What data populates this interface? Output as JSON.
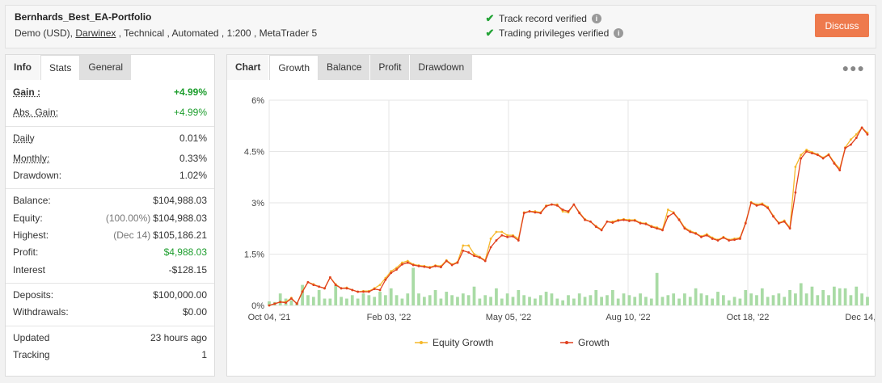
{
  "account": {
    "name": "Bernhards_Best_EA-Portfolio",
    "desc_prefix": "Demo (USD),",
    "broker": "Darwinex",
    "desc_suffix": ", Technical , Automated , 1:200 , MetaTrader 5"
  },
  "verification": [
    {
      "text": "Track record verified",
      "icon": "check-icon"
    },
    {
      "text": "Trading privileges verified",
      "icon": "check-icon"
    }
  ],
  "discuss_label": "Discuss",
  "left_tabs": [
    "Info",
    "Stats",
    "General"
  ],
  "stats": {
    "gain": {
      "label": "Gain :",
      "value": "+4.99%"
    },
    "abs_gain": {
      "label": "Abs. Gain:",
      "value": "+4.99%"
    },
    "daily": {
      "label": "Daily",
      "value": "0.01%"
    },
    "monthly": {
      "label": "Monthly:",
      "value": "0.33%"
    },
    "drawdown": {
      "label": "Drawdown:",
      "value": "1.02%"
    },
    "balance": {
      "label": "Balance:",
      "value": "$104,988.03"
    },
    "equity": {
      "label": "Equity:",
      "sub": "(100.00%)",
      "value": "$104,988.03"
    },
    "highest": {
      "label": "Highest:",
      "sub": "(Dec 14)",
      "value": "$105,186.21"
    },
    "profit": {
      "label": "Profit:",
      "value": "$4,988.03"
    },
    "interest": {
      "label": "Interest",
      "value": "-$128.15"
    },
    "deposits": {
      "label": "Deposits:",
      "value": "$100,000.00"
    },
    "withdrawals": {
      "label": "Withdrawals:",
      "value": "$0.00"
    },
    "updated": {
      "label": "Updated",
      "value": "23 hours ago"
    },
    "tracking": {
      "label": "Tracking",
      "value": "1"
    }
  },
  "right_tabs": [
    "Chart",
    "Growth",
    "Balance",
    "Profit",
    "Drawdown"
  ],
  "menu_icon": "more-dots-icon",
  "colors": {
    "accent": "#ee7a4d",
    "green": "#1e9e2e",
    "equity": "#f6b82b",
    "growth": "#e0401f",
    "bars": "#a9dba5"
  },
  "chart_data": {
    "type": "line",
    "y_ticks": [
      "6%",
      "4.5%",
      "3%",
      "1.5%",
      "0%"
    ],
    "y_tick_values": [
      6,
      4.5,
      3,
      1.5,
      0
    ],
    "ylim": [
      0,
      6
    ],
    "x_ticks": [
      "Oct 04, '21",
      "Feb 03, '22",
      "May 05, '22",
      "Aug 10, '22",
      "Oct 18, '22",
      "Dec 14, '22"
    ],
    "legend": [
      "Equity Growth",
      "Growth"
    ],
    "grid": true,
    "series": [
      {
        "name": "Growth",
        "values": [
          0,
          0.05,
          0.1,
          0.08,
          0.2,
          0.05,
          0.4,
          0.68,
          0.6,
          0.55,
          0.5,
          0.82,
          0.6,
          0.5,
          0.5,
          0.45,
          0.4,
          0.4,
          0.4,
          0.48,
          0.45,
          0.75,
          0.95,
          1.05,
          1.2,
          1.25,
          1.18,
          1.15,
          1.13,
          1.1,
          1.15,
          1.12,
          1.3,
          1.18,
          1.25,
          1.6,
          1.55,
          1.45,
          1.4,
          1.3,
          1.7,
          1.9,
          2.05,
          2.0,
          2.02,
          1.9,
          2.7,
          2.75,
          2.72,
          2.7,
          2.9,
          2.95,
          2.92,
          2.8,
          2.75,
          2.95,
          2.7,
          2.5,
          2.45,
          2.3,
          2.2,
          2.45,
          2.42,
          2.48,
          2.5,
          2.47,
          2.48,
          2.4,
          2.38,
          2.3,
          2.25,
          2.2,
          2.6,
          2.7,
          2.5,
          2.25,
          2.15,
          2.1,
          2.0,
          2.05,
          1.95,
          1.9,
          1.98,
          1.9,
          1.92,
          1.95,
          2.4,
          3.0,
          2.92,
          2.95,
          2.85,
          2.6,
          2.4,
          2.45,
          2.25,
          3.3,
          4.3,
          4.5,
          4.45,
          4.4,
          4.3,
          4.4,
          4.15,
          3.95,
          4.6,
          4.7,
          4.9,
          5.2,
          5.0
        ]
      },
      {
        "name": "Equity Growth",
        "values": [
          0,
          0.05,
          0.1,
          0.1,
          0.22,
          0.05,
          0.42,
          0.68,
          0.62,
          0.55,
          0.5,
          0.82,
          0.62,
          0.5,
          0.52,
          0.45,
          0.4,
          0.42,
          0.42,
          0.5,
          0.6,
          0.8,
          1.0,
          1.1,
          1.25,
          1.3,
          1.2,
          1.17,
          1.15,
          1.12,
          1.17,
          1.15,
          1.32,
          1.2,
          1.27,
          1.75,
          1.75,
          1.5,
          1.42,
          1.32,
          1.95,
          2.15,
          2.15,
          2.05,
          2.05,
          1.95,
          2.72,
          2.75,
          2.75,
          2.72,
          2.92,
          2.95,
          2.95,
          2.75,
          2.72,
          2.95,
          2.72,
          2.52,
          2.45,
          2.32,
          2.22,
          2.45,
          2.45,
          2.5,
          2.52,
          2.5,
          2.5,
          2.42,
          2.4,
          2.32,
          2.28,
          2.22,
          2.8,
          2.72,
          2.52,
          2.28,
          2.18,
          2.12,
          2.02,
          2.08,
          1.98,
          1.92,
          2.0,
          1.92,
          1.95,
          1.98,
          2.42,
          3.02,
          2.95,
          2.98,
          2.88,
          2.62,
          2.42,
          2.48,
          2.28,
          4.05,
          4.4,
          4.55,
          4.48,
          4.42,
          4.32,
          4.42,
          4.18,
          4.0,
          4.62,
          4.85,
          5.0,
          5.2,
          5.05
        ]
      },
      {
        "name": "Volume",
        "values": [
          0.12,
          0.1,
          0.35,
          0.2,
          0.15,
          0.1,
          0.6,
          0.3,
          0.25,
          0.45,
          0.2,
          0.2,
          0.6,
          0.25,
          0.2,
          0.3,
          0.2,
          0.35,
          0.3,
          0.25,
          0.4,
          0.3,
          0.5,
          0.3,
          0.2,
          0.35,
          1.1,
          0.35,
          0.25,
          0.3,
          0.45,
          0.2,
          0.4,
          0.3,
          0.25,
          0.35,
          0.3,
          0.55,
          0.2,
          0.3,
          0.25,
          0.5,
          0.2,
          0.35,
          0.25,
          0.45,
          0.3,
          0.25,
          0.2,
          0.3,
          0.4,
          0.35,
          0.2,
          0.15,
          0.3,
          0.2,
          0.35,
          0.25,
          0.3,
          0.45,
          0.25,
          0.3,
          0.45,
          0.2,
          0.35,
          0.3,
          0.25,
          0.35,
          0.25,
          0.2,
          0.95,
          0.25,
          0.3,
          0.35,
          0.2,
          0.35,
          0.25,
          0.5,
          0.35,
          0.3,
          0.2,
          0.4,
          0.3,
          0.15,
          0.25,
          0.2,
          0.45,
          0.35,
          0.3,
          0.5,
          0.25,
          0.3,
          0.35,
          0.25,
          0.45,
          0.35,
          0.65,
          0.35,
          0.55,
          0.3,
          0.45,
          0.3,
          0.55,
          0.5,
          0.5,
          0.3,
          0.55,
          0.35,
          0.25
        ]
      }
    ]
  }
}
